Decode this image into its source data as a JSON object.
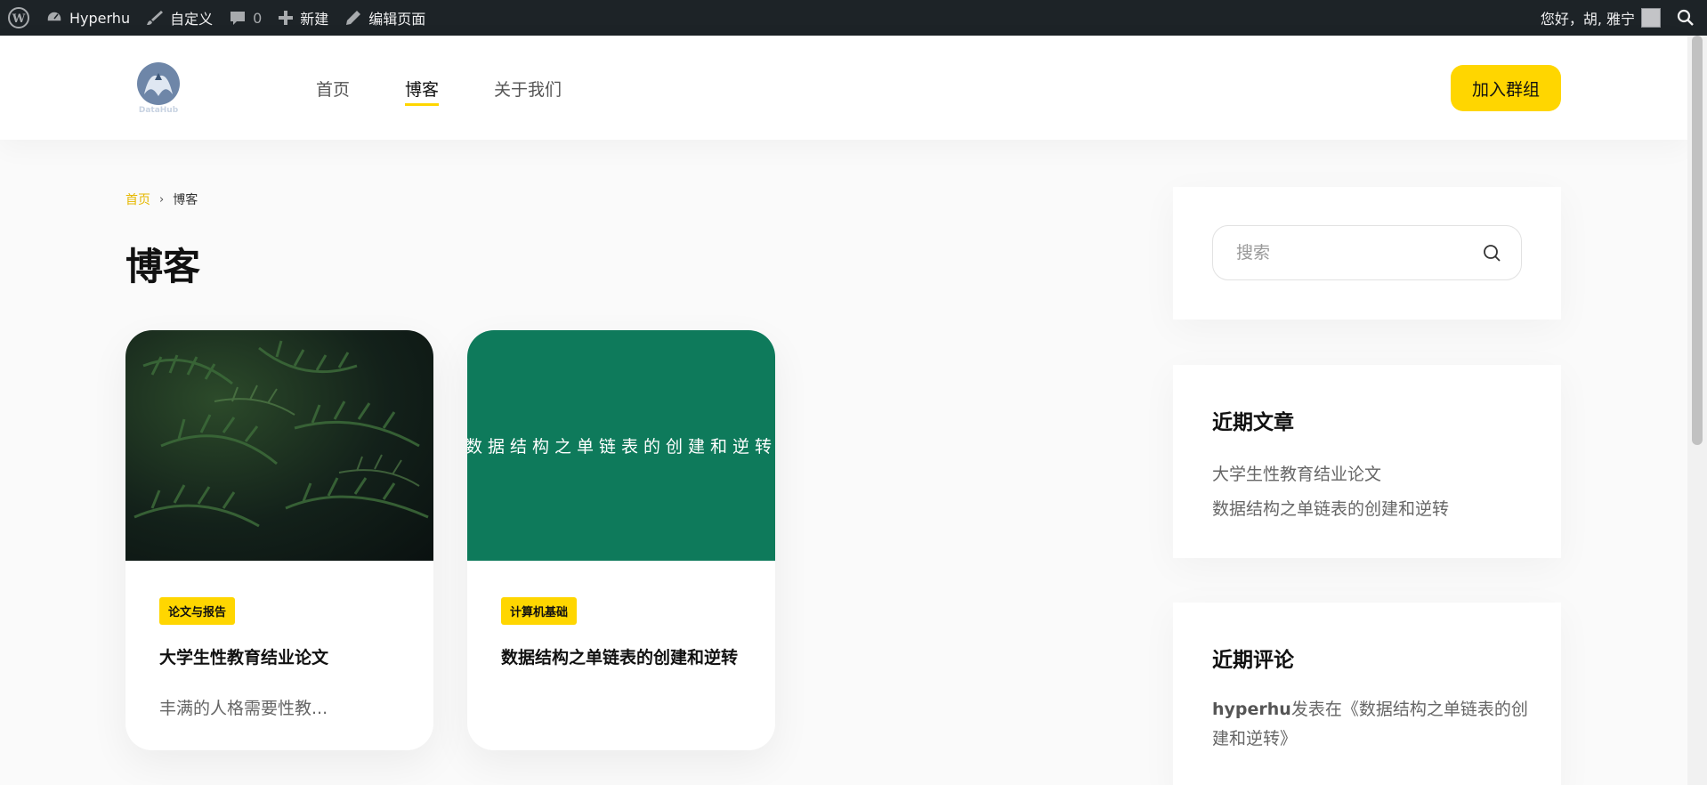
{
  "adminbar": {
    "site_name": "Hyperhu",
    "customize": "自定义",
    "comments_count": "0",
    "new": "新建",
    "edit_page": "编辑页面",
    "greeting": "您好，胡, 雅宁"
  },
  "header": {
    "logo_text": "DataHub",
    "nav": [
      "首页",
      "博客",
      "关于我们"
    ],
    "join_button": "加入群组"
  },
  "breadcrumb": {
    "home": "首页",
    "separator": "›",
    "current": "博客"
  },
  "page_title": "博客",
  "posts": [
    {
      "tag": "论文与报告",
      "title": "大学生性教育结业论文",
      "excerpt": "丰满的人格需要性教..."
    },
    {
      "tag": "计算机基础",
      "title": "数据结构之单链表的创建和逆转",
      "image_text": "数据结构之单链表的创建和逆转",
      "excerpt": ""
    }
  ],
  "sidebar": {
    "search_placeholder": "搜索",
    "recent_posts_title": "近期文章",
    "recent_posts": [
      "大学生性教育结业论文",
      "数据结构之单链表的创建和逆转"
    ],
    "recent_comments_title": "近期评论",
    "comment_author": "hyperhu",
    "comment_text": "发表在《数据结构之单链表的创建和逆转》"
  },
  "colors": {
    "accent": "#ffd600",
    "adminbar": "#1d2327",
    "green_card": "#0e7a5b"
  }
}
